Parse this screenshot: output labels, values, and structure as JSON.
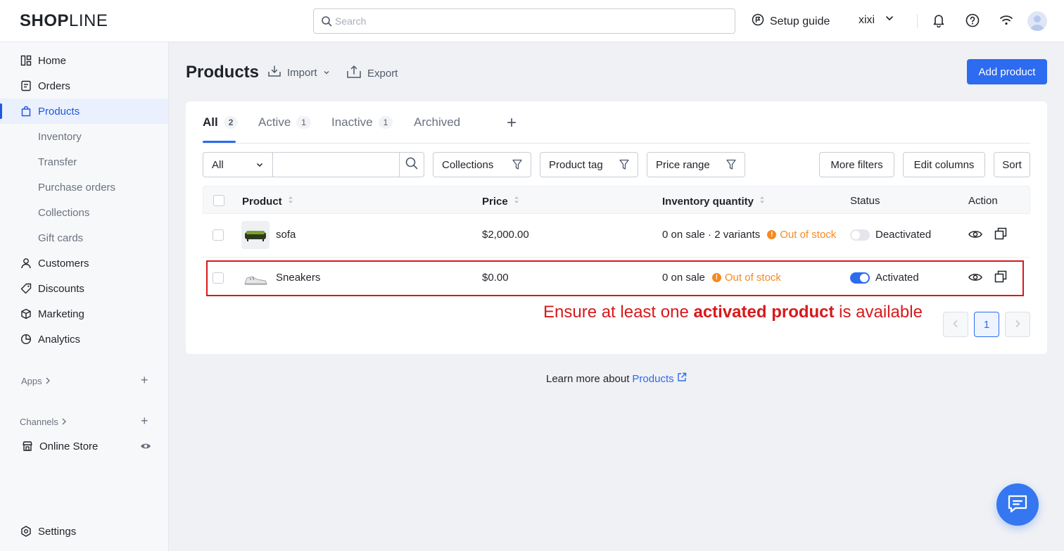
{
  "header": {
    "logo_main": "SHOP",
    "logo_thin": "LINE",
    "search_placeholder": "Search",
    "setup_guide": "Setup guide",
    "user_name": "xixi"
  },
  "sidebar": {
    "items": [
      {
        "label": "Home",
        "icon": "home-icon"
      },
      {
        "label": "Orders",
        "icon": "orders-icon"
      },
      {
        "label": "Products",
        "icon": "bag-icon"
      },
      {
        "label": "Customers",
        "icon": "person-icon"
      },
      {
        "label": "Discounts",
        "icon": "tag-icon"
      },
      {
        "label": "Marketing",
        "icon": "cube-icon"
      },
      {
        "label": "Analytics",
        "icon": "pie-icon"
      }
    ],
    "sub_items": [
      "Inventory",
      "Transfer",
      "Purchase orders",
      "Collections",
      "Gift cards"
    ],
    "apps_label": "Apps",
    "channels_label": "Channels",
    "online_store": "Online Store",
    "settings": "Settings"
  },
  "page": {
    "title": "Products",
    "import": "Import",
    "export": "Export",
    "add_product": "Add product"
  },
  "tabs": [
    {
      "label": "All",
      "count": "2"
    },
    {
      "label": "Active",
      "count": "1"
    },
    {
      "label": "Inactive",
      "count": "1"
    },
    {
      "label": "Archived",
      "count": ""
    }
  ],
  "filters": {
    "all_select": "All",
    "collections": "Collections",
    "product_tag": "Product tag",
    "price_range": "Price range",
    "more_filters": "More filters",
    "edit_columns": "Edit columns",
    "sort": "Sort"
  },
  "table": {
    "columns": [
      "Product",
      "Price",
      "Inventory quantity",
      "Status",
      "Action"
    ],
    "rows": [
      {
        "name": "sofa",
        "price": "$2,000.00",
        "inventory": "0 on sale · 2 variants",
        "stock": "Out of stock",
        "status": "Deactivated",
        "active": false
      },
      {
        "name": "Sneakers",
        "price": "$0.00",
        "inventory": "0 on sale",
        "stock": "Out of stock",
        "status": "Activated",
        "active": true
      }
    ]
  },
  "annotation": {
    "pre": "Ensure at least one ",
    "bold": "activated product",
    "post": " is available"
  },
  "pagination": {
    "current": "1"
  },
  "footer": {
    "learn_more": "Learn more about",
    "link": "Products"
  },
  "colors": {
    "primary": "#2d6bf0",
    "warning": "#f58a1f",
    "annotation": "#d7191c"
  }
}
